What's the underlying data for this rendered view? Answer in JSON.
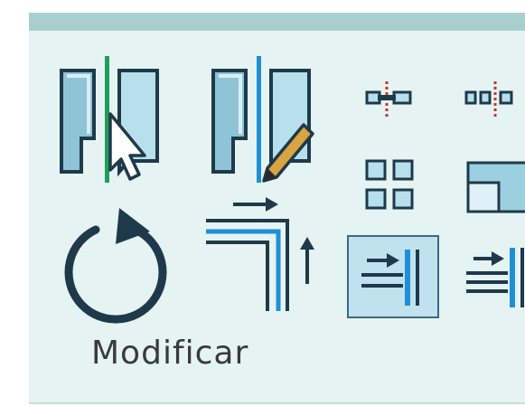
{
  "ribbon_panel": {
    "label": "Modificar",
    "colors": {
      "background": "#e6f3f3",
      "top_strip": "#a7cfcd",
      "icon_outline": "#1e3a4a",
      "icon_fill": "#9ccfe0",
      "accent_blue": "#1e90d6",
      "accent_green": "#1f9e5a",
      "active_border": "#3b6a80"
    },
    "tools": [
      {
        "icon": "align-icon",
        "state": "normal"
      },
      {
        "icon": "align-pencil-icon",
        "state": "normal"
      },
      {
        "icon": "move-link-icon",
        "state": "normal"
      },
      {
        "icon": "split-link-icon",
        "state": "normal"
      },
      {
        "icon": "array-grid-icon",
        "state": "normal"
      },
      {
        "icon": "scale-icon",
        "state": "normal"
      },
      {
        "icon": "rotate-icon",
        "state": "normal"
      },
      {
        "icon": "offset-trim-icon",
        "state": "normal"
      },
      {
        "icon": "trim-extend-single-icon",
        "state": "active"
      },
      {
        "icon": "trim-extend-multiple-icon",
        "state": "normal"
      }
    ]
  }
}
